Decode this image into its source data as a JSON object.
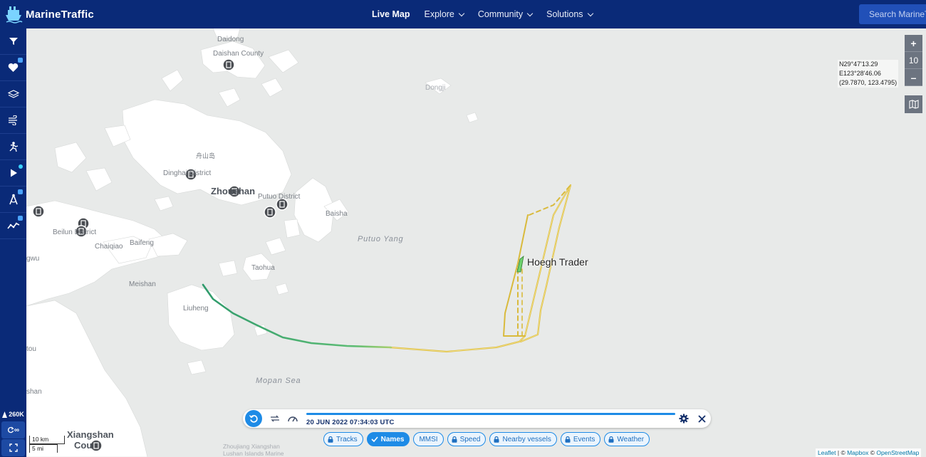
{
  "brand": {
    "name": "MarineTraffic"
  },
  "topnav": {
    "items": [
      {
        "label": "Live Map",
        "active": true
      },
      {
        "label": "Explore",
        "dropdown": true
      },
      {
        "label": "Community",
        "dropdown": true
      },
      {
        "label": "Solutions",
        "dropdown": true
      }
    ]
  },
  "search": {
    "placeholder": "Search MarineTraffic"
  },
  "sidebar": {
    "icons": [
      "filter-icon",
      "heart-icon",
      "layers-icon",
      "wind-icon",
      "route-icon",
      "play-icon",
      "measure-icon",
      "analytics-icon"
    ],
    "vessel_count": "260K",
    "infinity_label": "∞"
  },
  "map": {
    "zoom_level": "10",
    "coords": {
      "lat": "N29°47'13.29",
      "lon": "E123°28'46.06",
      "decimal": "(29.7870, 123.4795)"
    },
    "vessel": {
      "name": "Hoegh Trader",
      "color": "#6fd36f"
    },
    "places": [
      {
        "name": "Daidong",
        "kind": "town"
      },
      {
        "name": "Daishan County",
        "kind": "town"
      },
      {
        "name": "Dongji",
        "kind": "town"
      },
      {
        "name": "舟山岛",
        "kind": "town"
      },
      {
        "name": "Dinghai District",
        "kind": "town"
      },
      {
        "name": "Zhoushan",
        "kind": "city"
      },
      {
        "name": "Putuo District",
        "kind": "town"
      },
      {
        "name": "Baisha",
        "kind": "town"
      },
      {
        "name": "Putuo Yang",
        "kind": "sea"
      },
      {
        "name": "Beilun District",
        "kind": "town"
      },
      {
        "name": "Chaiqiao",
        "kind": "town"
      },
      {
        "name": "Baifeng",
        "kind": "town"
      },
      {
        "name": "Taohua",
        "kind": "town"
      },
      {
        "name": "gwu",
        "kind": "town"
      },
      {
        "name": "Meishan",
        "kind": "town"
      },
      {
        "name": "Liuheng",
        "kind": "town"
      },
      {
        "name": "Mopan Sea",
        "kind": "sea"
      },
      {
        "name": "tou",
        "kind": "town"
      },
      {
        "name": "shan",
        "kind": "town"
      },
      {
        "name": "Xiangshan",
        "kind": "city"
      },
      {
        "name": "Cou",
        "kind": "city"
      },
      {
        "name": "Zhoujiang Xiangshan",
        "kind": "faint"
      },
      {
        "name": "Lushan Islands Marine",
        "kind": "faint"
      }
    ],
    "scale": {
      "metric": "10 km",
      "imperial": "5 mi"
    },
    "attribution": {
      "leaflet": "Leaflet",
      "sep": " | © ",
      "mapbox": "Mapbox",
      "sep2": " © ",
      "osm": "OpenStreetMap"
    }
  },
  "playback": {
    "timestamp": "20 JUN 2022 07:34:03 UTC",
    "progress": 1.0
  },
  "chips": [
    {
      "label": "Tracks",
      "locked": true,
      "active": false
    },
    {
      "label": "Names",
      "locked": false,
      "active": true
    },
    {
      "label": "MMSI",
      "locked": false,
      "active": false
    },
    {
      "label": "Speed",
      "locked": true,
      "active": false
    },
    {
      "label": "Nearby vessels",
      "locked": true,
      "active": false
    },
    {
      "label": "Events",
      "locked": true,
      "active": false
    },
    {
      "label": "Weather",
      "locked": true,
      "active": false
    }
  ],
  "colors": {
    "navbar": "#0a2a78",
    "accent": "#1e8be6",
    "land": "#ffffff",
    "sea": "#e8eae9",
    "track_recent": "#4cbb7a",
    "track_history": "#e4c84a"
  }
}
